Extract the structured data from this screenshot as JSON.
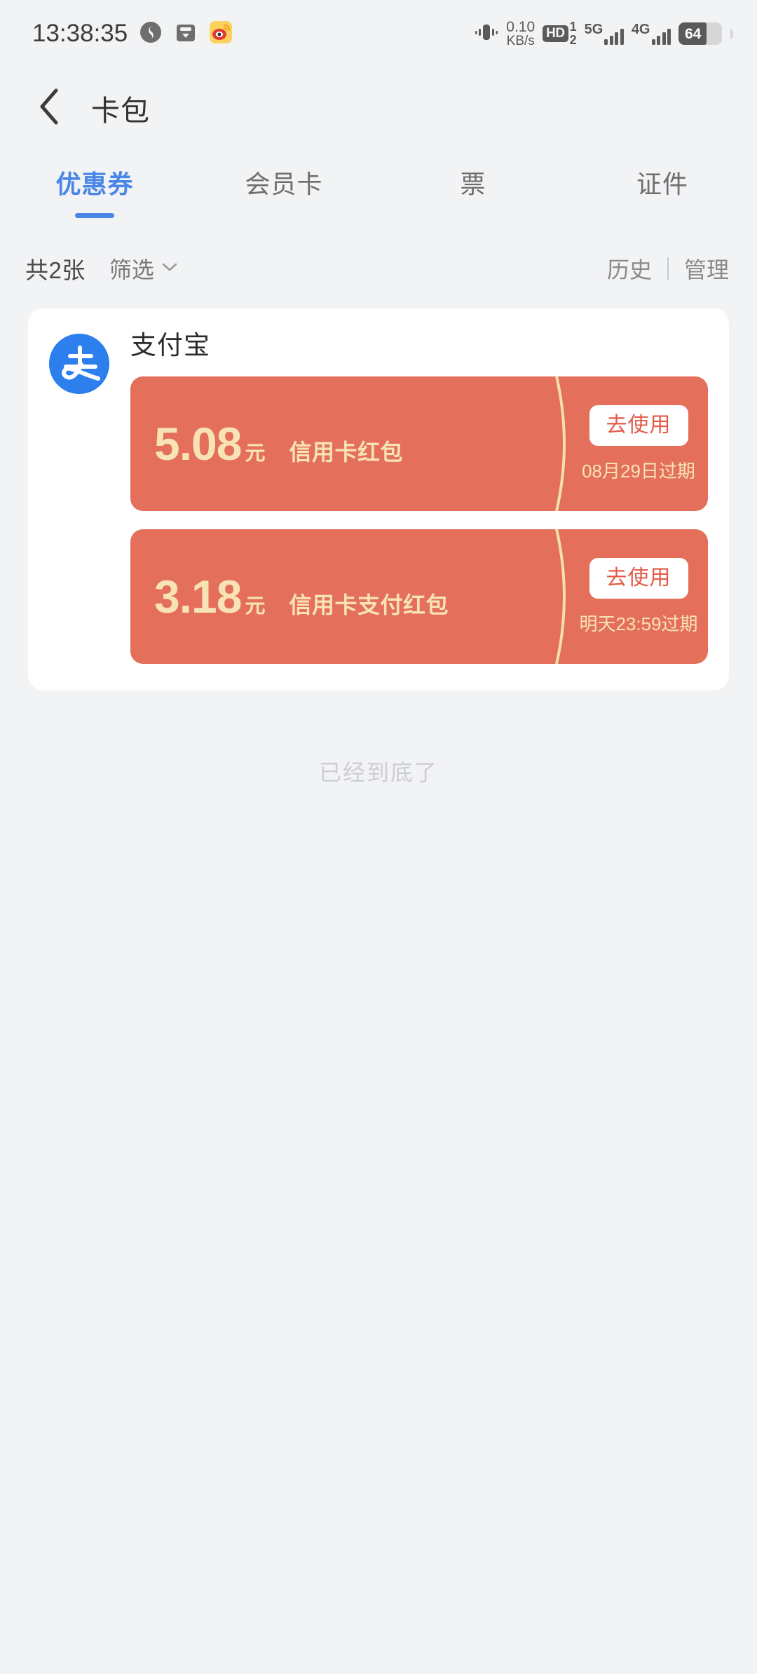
{
  "status_bar": {
    "time": "13:38:35",
    "left_icons": [
      "swirl-app-icon",
      "download-box-icon",
      "weibo-app-icon"
    ],
    "network_speed_value": "0.10",
    "network_speed_unit": "KB/s",
    "hd_label": "HD",
    "sim1_label": "1",
    "sim2_label": "2",
    "signal_5g_label": "5G",
    "signal_4g_label": "4G",
    "battery_percent": "64",
    "vibrate_icon": "vibrate-icon"
  },
  "nav": {
    "back_icon": "back-chevron-icon",
    "title": "卡包"
  },
  "tabs": [
    {
      "label": "优惠券",
      "active": true
    },
    {
      "label": "会员卡",
      "active": false
    },
    {
      "label": "票",
      "active": false
    },
    {
      "label": "证件",
      "active": false
    }
  ],
  "filter_bar": {
    "count_text": "共2张",
    "filter_label": "筛选",
    "chevron_icon": "chevron-down-icon",
    "history_label": "历史",
    "manage_label": "管理"
  },
  "merchant": {
    "logo_icon": "alipay-logo-icon",
    "logo_glyph": "支",
    "name": "支付宝"
  },
  "coupons": [
    {
      "amount": "5.08",
      "unit": "元",
      "name": "信用卡红包",
      "action_label": "去使用",
      "expiry": "08月29日过期"
    },
    {
      "amount": "3.18",
      "unit": "元",
      "name": "信用卡支付红包",
      "action_label": "去使用",
      "expiry": "明天23:59过期"
    }
  ],
  "footer": {
    "end_of_list": "已经到底了"
  },
  "colors": {
    "page_background": "#F2F3F5",
    "accent_blue": "#4A86E8",
    "coupon_red": "#E4705C",
    "coupon_cream": "#F8E3B6",
    "alipay_blue": "#2E7FEE",
    "use_button_text": "#E25C48"
  }
}
